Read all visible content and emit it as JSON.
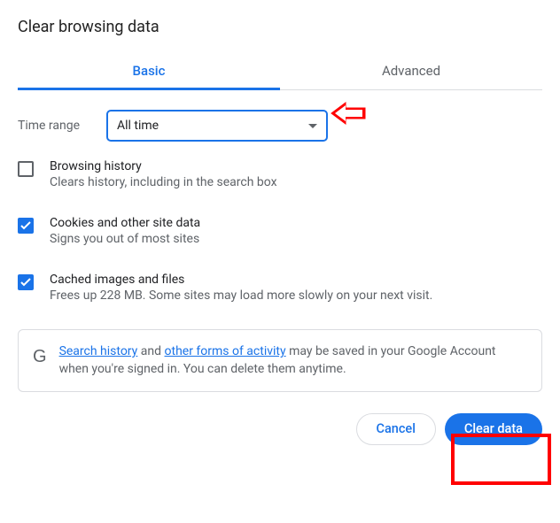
{
  "title": "Clear browsing data",
  "tabs": {
    "basic": "Basic",
    "advanced": "Advanced"
  },
  "time_range": {
    "label": "Time range",
    "value": "All time"
  },
  "options": [
    {
      "title": "Browsing history",
      "desc": "Clears history, including in the search box",
      "checked": false
    },
    {
      "title": "Cookies and other site data",
      "desc": "Signs you out of most sites",
      "checked": true
    },
    {
      "title": "Cached images and files",
      "desc": "Frees up 228 MB. Some sites may load more slowly on your next visit.",
      "checked": true
    }
  ],
  "info": {
    "link1": "Search history",
    "mid1": " and ",
    "link2": "other forms of activity",
    "rest": " may be saved in your Google Account when you're signed in. You can delete them anytime."
  },
  "buttons": {
    "cancel": "Cancel",
    "clear": "Clear data"
  }
}
